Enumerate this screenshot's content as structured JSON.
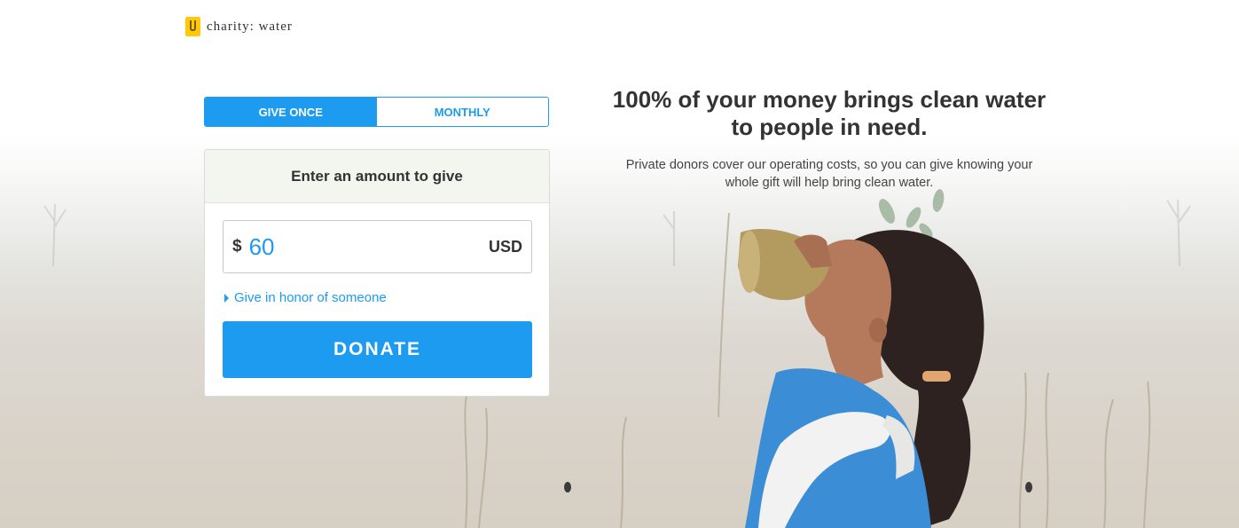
{
  "header": {
    "logo_text": "charity: water",
    "logo_icon": "jerrycan-icon"
  },
  "frequency": {
    "options": [
      "GIVE ONCE",
      "MONTHLY"
    ],
    "selected": "GIVE ONCE"
  },
  "donation_form": {
    "heading": "Enter an amount to give",
    "currency_symbol": "$",
    "amount_value": "60",
    "currency_code": "USD",
    "honor_link": "Give in honor of someone",
    "donate_label": "DONATE"
  },
  "hero": {
    "headline": "100% of your money brings clean water to people in need.",
    "subtext": "Private donors cover our operating costs, so you can give knowing your whole gift will help bring clean water."
  },
  "colors": {
    "accent": "#1c9bf0",
    "logo_yellow": "#ffc907",
    "form_header_bg": "#f3f5ef",
    "text_dark": "#333333"
  }
}
